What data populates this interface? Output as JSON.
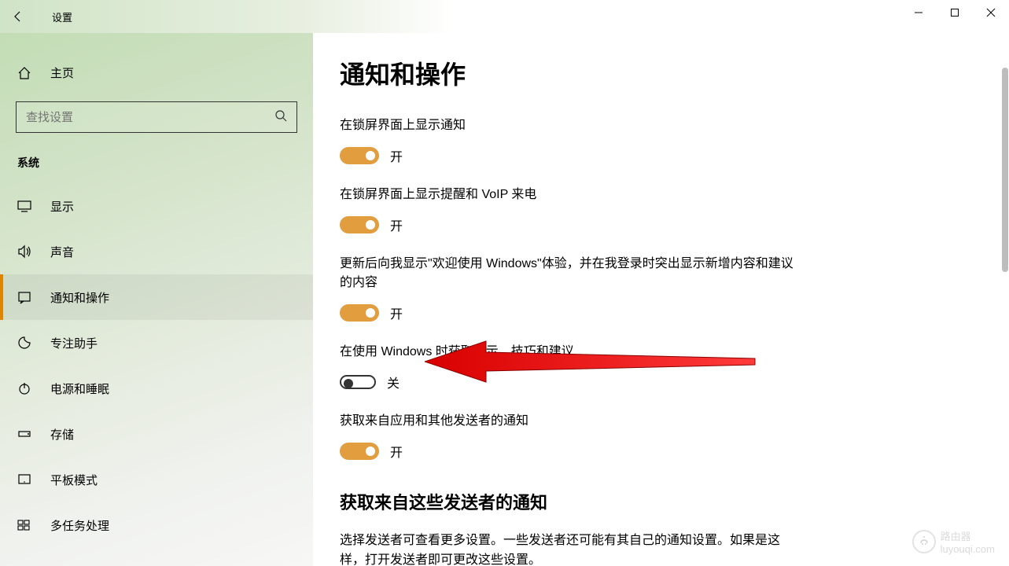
{
  "titlebar": {
    "title": "设置"
  },
  "sidebar": {
    "home": "主页",
    "search_placeholder": "查找设置",
    "category": "系统",
    "items": [
      {
        "icon": "display-icon",
        "label": "显示"
      },
      {
        "icon": "sound-icon",
        "label": "声音"
      },
      {
        "icon": "notifications-icon",
        "label": "通知和操作",
        "selected": true
      },
      {
        "icon": "focus-icon",
        "label": "专注助手"
      },
      {
        "icon": "power-icon",
        "label": "电源和睡眠"
      },
      {
        "icon": "storage-icon",
        "label": "存储"
      },
      {
        "icon": "tablet-icon",
        "label": "平板模式"
      },
      {
        "icon": "multitask-icon",
        "label": "多任务处理"
      }
    ]
  },
  "main": {
    "title": "通知和操作",
    "settings": [
      {
        "label": "在锁屏界面上显示通知",
        "state": "on",
        "text": "开"
      },
      {
        "label": "在锁屏界面上显示提醒和 VoIP 来电",
        "state": "on",
        "text": "开"
      },
      {
        "label": "更新后向我显示\"欢迎使用 Windows\"体验，并在我登录时突出显示新增内容和建议的内容",
        "state": "on",
        "text": "开"
      },
      {
        "label": "在使用 Windows 时获取提示、技巧和建议",
        "state": "off",
        "text": "关"
      },
      {
        "label": "获取来自应用和其他发送者的通知",
        "state": "on",
        "text": "开"
      }
    ],
    "section2_title": "获取来自这些发送者的通知",
    "section2_desc": "选择发送者可查看更多设置。一些发送者还可能有其自己的通知设置。如果是这样，打开发送者即可更改这些设置。"
  },
  "watermark": {
    "top": "路由器",
    "bottom": "luyouqi.com"
  }
}
